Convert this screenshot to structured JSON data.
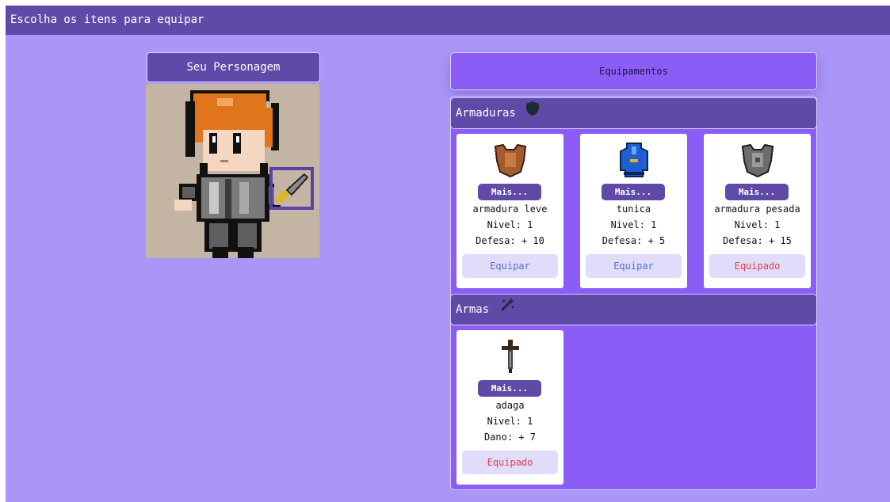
{
  "header": {
    "title": "Escolha os itens para equipar"
  },
  "character": {
    "title": "Seu Personagem"
  },
  "equipment": {
    "title": "Equipamentos"
  },
  "sections": {
    "armor": {
      "title": "Armaduras",
      "icon": "shield-icon",
      "items": [
        {
          "name": "armadura leve",
          "level": "Nivel: 1",
          "stat": "Defesa: + 10",
          "more": "Mais...",
          "action": "Equipar",
          "icon": "leather-armor-icon",
          "color": "#a35c2f"
        },
        {
          "name": "tunica",
          "level": "Nivel: 1",
          "stat": "Defesa: + 5",
          "more": "Mais...",
          "action": "Equipar",
          "icon": "tunic-icon",
          "color": "#1f5fd1"
        },
        {
          "name": "armadura pesada",
          "level": "Nivel: 1",
          "stat": "Defesa: + 15",
          "more": "Mais...",
          "action": "Equipado",
          "icon": "heavy-armor-icon",
          "color": "#6c6c6c"
        }
      ]
    },
    "weapons": {
      "title": "Armas",
      "icon": "magic-wand-icon",
      "items": [
        {
          "name": "adaga",
          "level": "Nivel: 1",
          "stat": "Dano: + 7",
          "more": "Mais...",
          "action": "Equipado",
          "icon": "dagger-icon",
          "color": "#3a2a1e"
        }
      ]
    }
  },
  "colors": {
    "background": "#a996f6",
    "header": "#5f4aa8",
    "panel": "#8b5cf6",
    "equip_text": "#5273d8",
    "equipped_text": "#e1414f"
  }
}
